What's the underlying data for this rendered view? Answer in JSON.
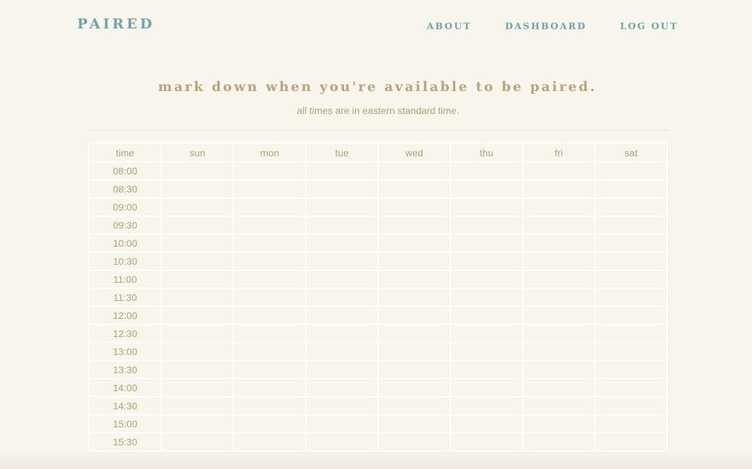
{
  "header": {
    "brand": "PAIRED",
    "nav": [
      "ABOUT",
      "DASHBOARD",
      "LOG OUT"
    ]
  },
  "main": {
    "title": "mark down when you're available to be paired.",
    "subtitle": "all times are in eastern standard time."
  },
  "schedule": {
    "columns": [
      "time",
      "sun",
      "mon",
      "tue",
      "wed",
      "thu",
      "fri",
      "sat"
    ],
    "times": [
      "08:00",
      "08:30",
      "09:00",
      "09:30",
      "10:00",
      "10:30",
      "11:00",
      "11:30",
      "12:00",
      "12:30",
      "13:00",
      "13:30",
      "14:00",
      "14:30",
      "15:00",
      "15:30"
    ]
  }
}
